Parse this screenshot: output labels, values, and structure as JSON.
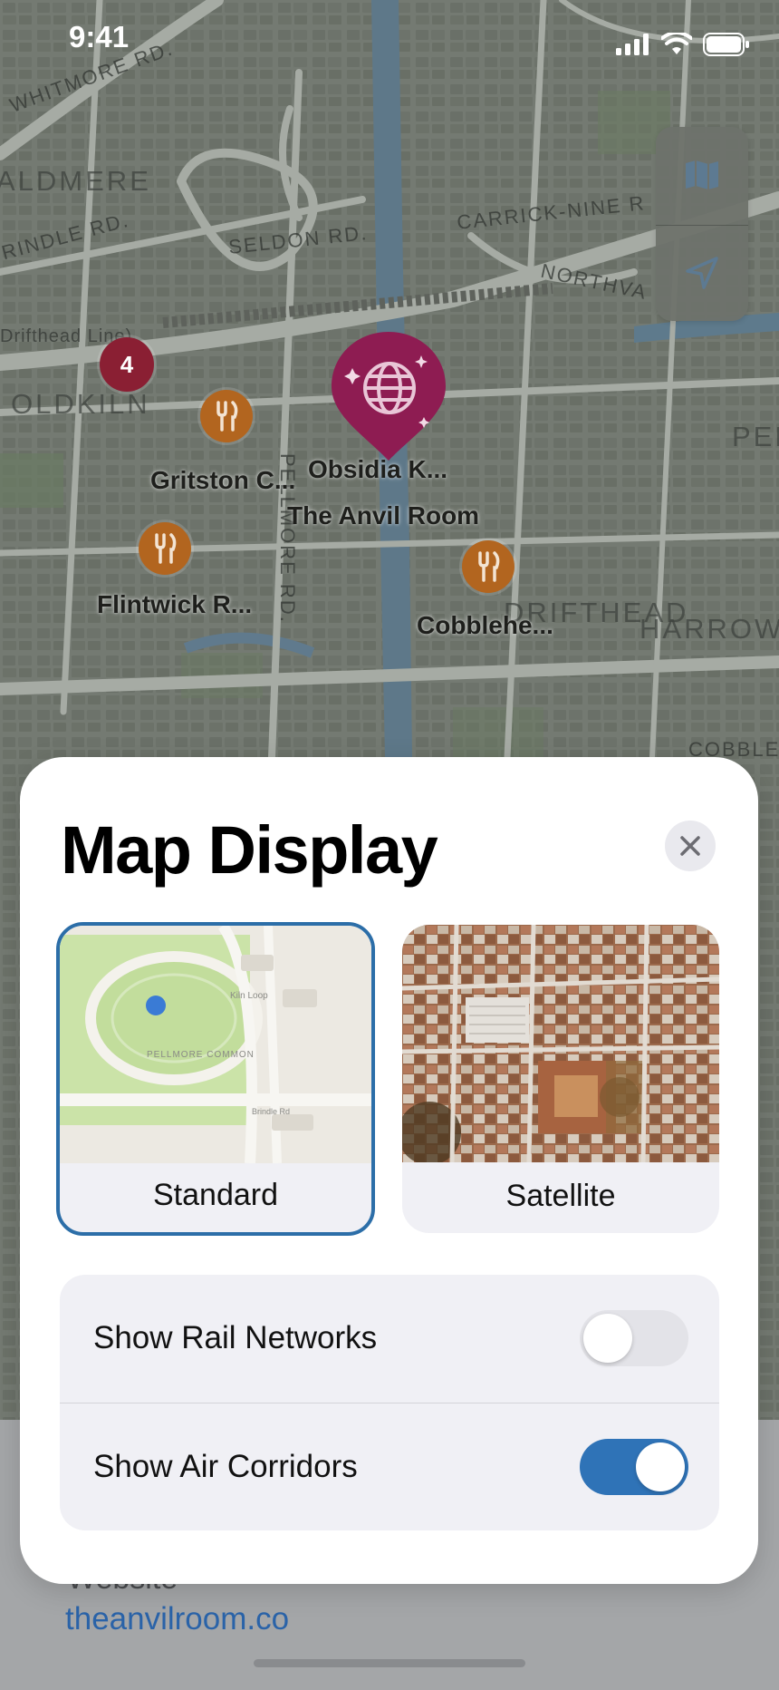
{
  "status_bar": {
    "time": "9:41"
  },
  "map": {
    "streets": [
      "WHITMORE RD.",
      "ALDMERE",
      "RINDLE RD.",
      "SELDON RD.",
      "CARRICK-NINE R",
      "NORTHVA",
      "Drifthead Line)",
      "OLDKILN",
      "PELLMORE RD.",
      "PEL",
      "DRIFTHEAD",
      "HARROW",
      "COBBLE"
    ],
    "cluster_count": "4",
    "pois": {
      "featured": "Obsidia K...",
      "gritston": "Gritston C...",
      "anvil": "The Anvil Room",
      "flintwick": "Flintwick R...",
      "cobble": "Cobblehe..."
    },
    "colors": {
      "poi_restaurant": "#b2651f",
      "poi_featured": "#8e1c52",
      "cluster": "#8a1f33"
    }
  },
  "place_sheet": {
    "website_label": "Website",
    "website_url": "theanvilroom.co"
  },
  "modal": {
    "title": "Map Display",
    "map_types": [
      {
        "label": "Standard",
        "selected": true,
        "preview_labels": {
          "road1": "Kiln Loop",
          "park": "PELLMORE COMMON",
          "road2": "Brindle Rd"
        }
      },
      {
        "label": "Satellite",
        "selected": false
      }
    ],
    "toggles": [
      {
        "label": "Show Rail Networks",
        "on": false
      },
      {
        "label": "Show Air Corridors",
        "on": true
      }
    ],
    "colors": {
      "accent": "#2f73b7",
      "selected_border": "#2c6ea8"
    }
  }
}
